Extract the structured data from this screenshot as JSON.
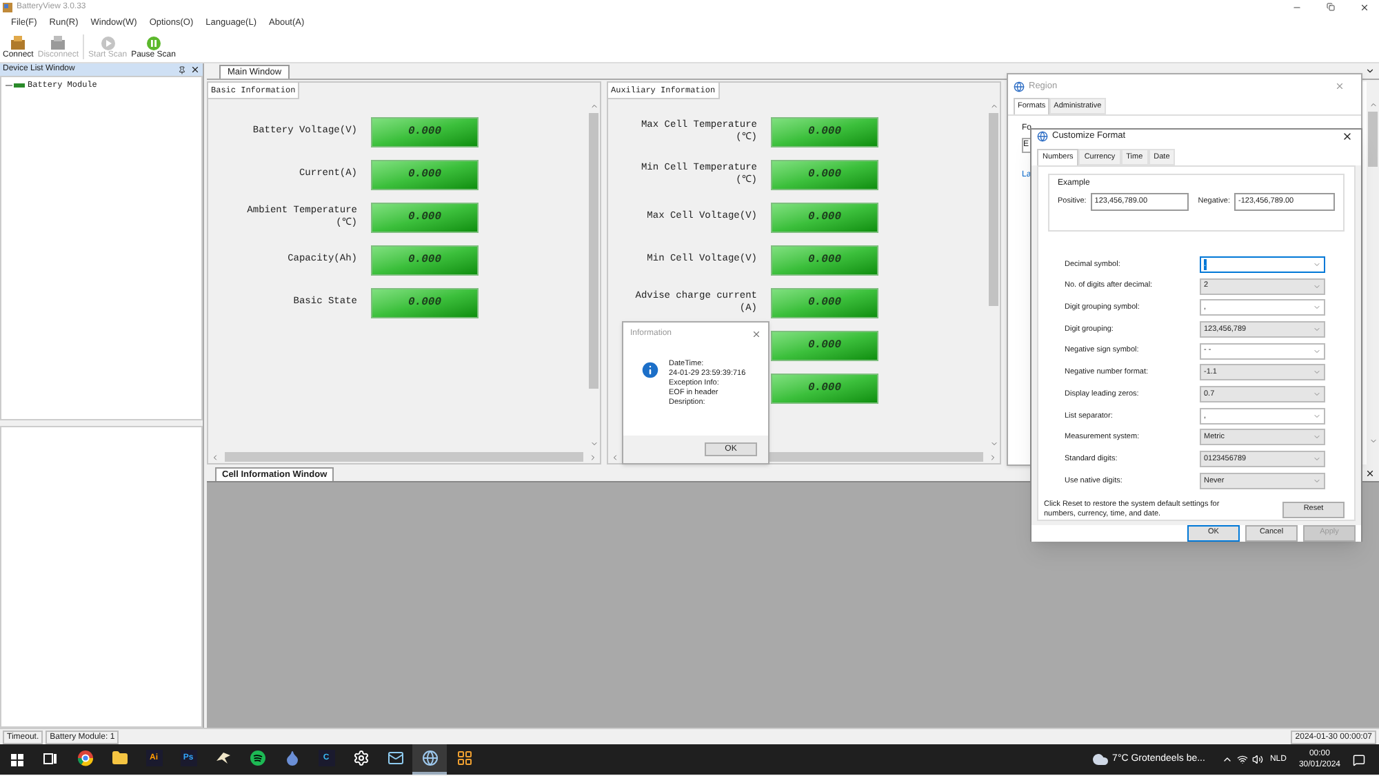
{
  "app": {
    "title": "BatteryView 3.0.33"
  },
  "menu": [
    "File(F)",
    "Run(R)",
    "Window(W)",
    "Options(O)",
    "Language(L)",
    "About(A)"
  ],
  "toolbar": [
    {
      "label": "Connect",
      "kind": "connect",
      "disabled": false
    },
    {
      "label": "Disconnect",
      "kind": "disconnect",
      "disabled": true
    },
    {
      "label": "Start Scan",
      "kind": "start",
      "disabled": true
    },
    {
      "label": "Pause Scan",
      "kind": "pause",
      "disabled": false
    }
  ],
  "device_list": {
    "title": "Device List Window",
    "items": [
      {
        "label": "Battery Module"
      }
    ]
  },
  "main_tab": {
    "label": "Main Window"
  },
  "basic": {
    "title": "Basic Information",
    "rows": [
      {
        "label": "Battery Voltage(V)",
        "value": "0.000"
      },
      {
        "label": "Current(A)",
        "value": "0.000"
      },
      {
        "label": "Ambient Temperature\n(℃)",
        "value": "0.000"
      },
      {
        "label": "Capacity(Ah)",
        "value": "0.000"
      },
      {
        "label": "Basic State",
        "value": "0.000"
      }
    ]
  },
  "auxiliary": {
    "title": "Auxiliary Information",
    "rows": [
      {
        "label": "Max Cell Temperature\n(℃)",
        "value": "0.000"
      },
      {
        "label": "Min Cell Temperature\n(℃)",
        "value": "0.000"
      },
      {
        "label": "Max Cell Voltage(V)",
        "value": "0.000"
      },
      {
        "label": "Min Cell Voltage(V)",
        "value": "0.000"
      },
      {
        "label": "Advise charge current\n(A)",
        "value": "0.000"
      },
      {
        "value": "0.000"
      },
      {
        "value": "0.000"
      }
    ]
  },
  "cell_tab": {
    "label": "Cell Information Window"
  },
  "status_bar": [
    "Timeout.",
    "Battery Module: 1",
    "2024-01-30 00:00:07"
  ],
  "info_dialog": {
    "title": "Information",
    "lines": [
      "DateTime:",
      "24-01-29 23:59:39:716",
      "Exception Info:",
      "EOF in header",
      "Desription:"
    ],
    "button": "OK"
  },
  "region": {
    "title": "Region",
    "tabs": [
      {
        "label": "Formats",
        "selected": true
      },
      {
        "label": "Administrative",
        "selected": false
      }
    ],
    "fragments": [
      "Fo",
      "E",
      "La"
    ]
  },
  "customize": {
    "title": "Customize Format",
    "tabs": [
      {
        "label": "Numbers",
        "selected": true
      },
      {
        "label": "Currency",
        "selected": false
      },
      {
        "label": "Time",
        "selected": false
      },
      {
        "label": "Date",
        "selected": false
      }
    ],
    "example": {
      "title": "Example",
      "positive_label": "Positive:",
      "positive": "123,456,789.00",
      "negative_label": "Negative:",
      "negative": "-123,456,789.00"
    },
    "settings": [
      {
        "label": "Decimal symbol:",
        "value": ".",
        "kind": "editable",
        "focused": true
      },
      {
        "label": "No. of digits after decimal:",
        "value": "2",
        "kind": "list",
        "focused": false
      },
      {
        "label": "Digit grouping symbol:",
        "value": ",",
        "kind": "editable",
        "focused": false
      },
      {
        "label": "Digit grouping:",
        "value": "123,456,789",
        "kind": "list",
        "focused": false
      },
      {
        "label": "Negative sign symbol:",
        "value": "- -",
        "kind": "editable",
        "focused": false
      },
      {
        "label": "Negative number format:",
        "value": "-1.1",
        "kind": "list",
        "focused": false
      },
      {
        "label": "Display leading zeros:",
        "value": "0.7",
        "kind": "list",
        "focused": false
      },
      {
        "label": "List separator:",
        "value": ",",
        "kind": "editable",
        "focused": false
      },
      {
        "label": "Measurement system:",
        "value": "Metric",
        "kind": "list",
        "focused": false
      },
      {
        "label": "Standard digits:",
        "value": "0123456789",
        "kind": "list",
        "focused": false
      },
      {
        "label": "Use native digits:",
        "value": "Never",
        "kind": "list",
        "focused": false
      }
    ],
    "note": "Click Reset to restore the system default settings for numbers, currency, time, and date.",
    "reset": "Reset",
    "buttons": [
      {
        "label": "OK",
        "default": true,
        "disabled": false
      },
      {
        "label": "Cancel",
        "default": false,
        "disabled": false
      },
      {
        "label": "Apply",
        "default": false,
        "disabled": true
      }
    ]
  },
  "taskbar": {
    "apps": [
      {
        "kind": "taskview",
        "active": false
      },
      {
        "kind": "browser",
        "active": false
      },
      {
        "kind": "folder",
        "active": false
      },
      {
        "kind": "badge",
        "label": "Ai",
        "color": "#ff9a00",
        "active": false
      },
      {
        "kind": "badge",
        "label": "Ps",
        "color": "#31a8ff",
        "active": false
      },
      {
        "kind": "bird",
        "active": false
      },
      {
        "kind": "music",
        "active": false
      },
      {
        "kind": "drop",
        "active": false
      },
      {
        "kind": "badge",
        "label": "C",
        "color": "#38bdf8",
        "active": false
      },
      {
        "kind": "gear",
        "active": false
      },
      {
        "kind": "mail",
        "active": false
      },
      {
        "kind": "globe",
        "active": true
      },
      {
        "kind": "grid",
        "active": false
      }
    ],
    "weather": "7°C Grotendeels be...",
    "language": "NLD",
    "time": "00:00",
    "date": "30/01/2024"
  }
}
